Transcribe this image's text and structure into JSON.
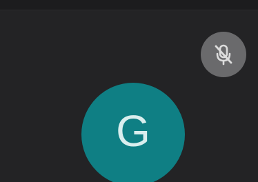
{
  "participant": {
    "initial": "G",
    "avatar_color": "#0f7f84",
    "mic_status_icon": "microphone-muted-icon"
  },
  "colors": {
    "background": "#1c1c1e",
    "tile": "#232325",
    "badge": "#6a6a6c"
  }
}
